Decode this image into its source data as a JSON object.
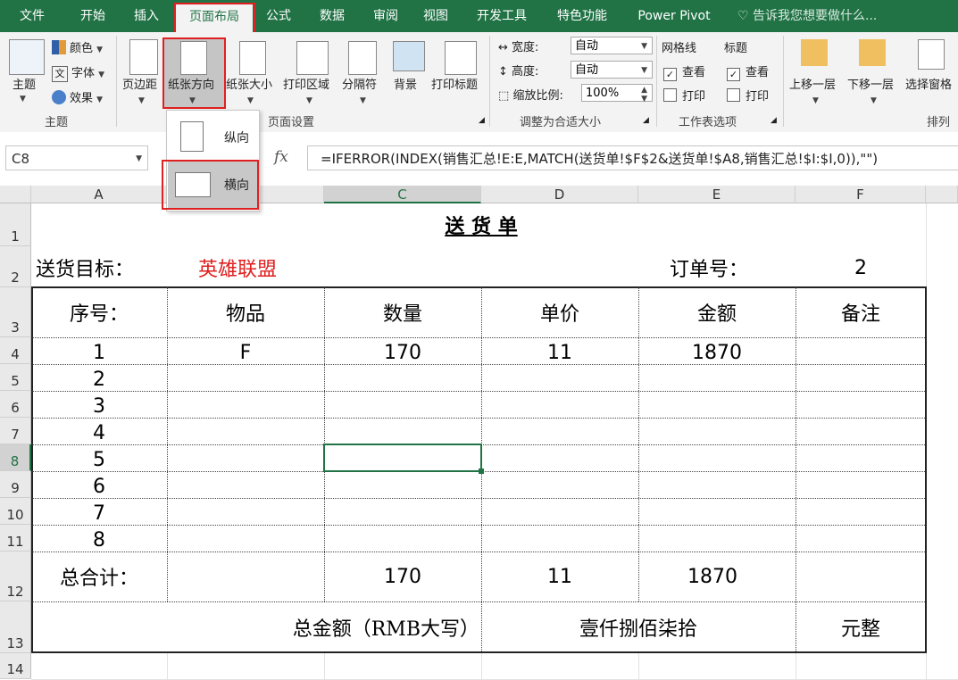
{
  "tabs": [
    "文件",
    "开始",
    "插入",
    "页面布局",
    "公式",
    "数据",
    "审阅",
    "视图",
    "开发工具",
    "特色功能",
    "Power Pivot"
  ],
  "tell_me": "告诉我您想要做什么...",
  "ribbon": {
    "theme_group": {
      "name": "主题",
      "theme_btn": "主题",
      "colors": "颜色",
      "fonts": "字体",
      "effects": "效果"
    },
    "page_setup_group": {
      "name": "页面设置",
      "margins": "页边距",
      "orientation": "纸张方向",
      "size": "纸张大小",
      "print_area": "打印区域",
      "breaks": "分隔符",
      "background": "背景",
      "print_titles": "打印标题"
    },
    "scale_group": {
      "name": "调整为合适大小",
      "width_label": "宽度:",
      "width_value": "自动",
      "height_label": "高度:",
      "height_value": "自动",
      "scale_label": "缩放比例:",
      "scale_value": "100%"
    },
    "sheet_options_group": {
      "name": "工作表选项",
      "gridlines": "网格线",
      "headings": "标题",
      "view1": "查看",
      "print1": "打印",
      "view2": "查看",
      "print2": "打印"
    },
    "arrange_group": {
      "name": "排列",
      "bring_forward": "上移一层",
      "send_backward": "下移一层",
      "selection_pane": "选择窗格"
    }
  },
  "orientation_menu": {
    "portrait": "纵向",
    "landscape": "横向"
  },
  "formula_bar": {
    "name_box": "C8",
    "fx": "fx",
    "formula": "=IFERROR(INDEX(销售汇总!E:E,MATCH(送货单!$F$2&送货单!$A8,销售汇总!$I:$I,0)),\"\")"
  },
  "columns": [
    "A",
    "C",
    "D",
    "E",
    "F"
  ],
  "rows": [
    "1",
    "2",
    "3",
    "4",
    "5",
    "6",
    "7",
    "8",
    "9",
    "10",
    "11",
    "12",
    "13",
    "14"
  ],
  "sheet": {
    "title": "送 货 单",
    "target_label": "送货目标：",
    "target_value": "英雄联盟",
    "order_label": "订单号：",
    "order_value": "2",
    "headers": [
      "序号：",
      "物品",
      "数量",
      "单价",
      "金额",
      "备注"
    ],
    "seq": [
      "1",
      "2",
      "3",
      "4",
      "5",
      "6",
      "7",
      "8"
    ],
    "row4": {
      "item": "F",
      "qty": "170",
      "price": "11",
      "amount": "1870"
    },
    "total_label": "总合计：",
    "total_qty": "170",
    "total_price": "11",
    "total_amount": "1870",
    "rmb_label": "总金额（RMB大写）",
    "rmb_value": "壹仟捌佰柒拾",
    "rmb_suffix": "元整"
  },
  "colors": {
    "accent": "#217346",
    "highlight": "#e02020",
    "target_text": "#e02020"
  }
}
